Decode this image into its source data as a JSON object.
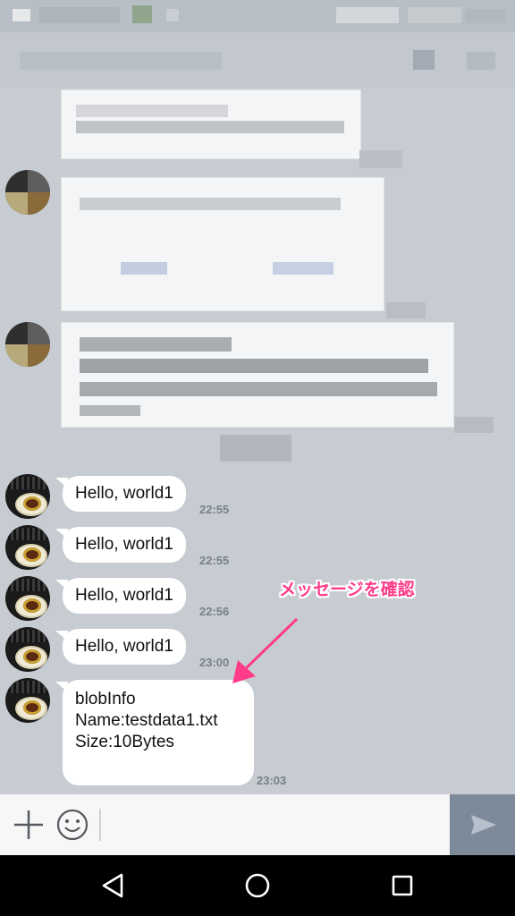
{
  "status_bar": {
    "icons": [
      "notification-icon",
      "signal-icon",
      "battery-icon"
    ]
  },
  "header": {
    "title": ""
  },
  "messages": [
    {
      "text": "Hello, world1",
      "time": "22:55"
    },
    {
      "text": "Hello, world1",
      "time": "22:55"
    },
    {
      "text": "Hello, world1",
      "time": "22:56"
    },
    {
      "text": "Hello, world1",
      "time": "23:00"
    },
    {
      "text_lines": [
        "blobInfo",
        "Name:testdata1.txt",
        "Size:10Bytes"
      ],
      "time": "23:03"
    }
  ],
  "annotation": {
    "text": "メッセージを確認",
    "color": "#ff3b8a"
  },
  "input_bar": {
    "add_icon": "plus-icon",
    "emoji_icon": "smiley-icon",
    "placeholder": "",
    "send_icon": "send-arrow-icon",
    "send_bg": "#7d8a99"
  },
  "nav_bar": {
    "icons": [
      "back-triangle-icon",
      "home-circle-icon",
      "recents-square-icon"
    ]
  },
  "colors": {
    "chat_bg": "#c7ccd2",
    "bubble_bg": "#ffffff",
    "time_text": "#7a8088"
  }
}
